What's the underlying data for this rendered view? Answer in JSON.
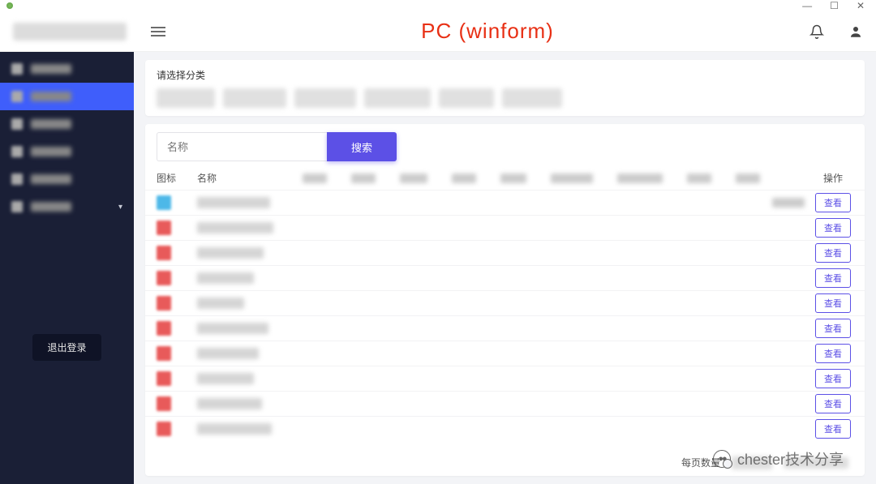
{
  "window": {
    "minimize": "—",
    "maximize": "☐",
    "close": "✕"
  },
  "header": {
    "title": "PC (winform)",
    "bell_icon": "bell-icon",
    "user_icon": "user-icon"
  },
  "sidebar": {
    "items": [
      {
        "label": "████",
        "active": false
      },
      {
        "label": "████",
        "active": true
      },
      {
        "label": "████站",
        "active": false
      },
      {
        "label": "███",
        "active": false
      },
      {
        "label": "█████站",
        "active": false
      },
      {
        "label": "███████",
        "active": false,
        "has_chevron": true
      }
    ],
    "logout": "退出登录"
  },
  "category": {
    "label": "请选择分类",
    "chips_widths": [
      72,
      78,
      76,
      82,
      68,
      74
    ]
  },
  "search": {
    "placeholder": "名称",
    "button": "搜索"
  },
  "table": {
    "headers": {
      "icon": "图标",
      "name": "名称",
      "op": "操作"
    },
    "mid_widths": [
      30,
      30,
      34,
      30,
      32,
      52,
      56,
      30,
      30
    ],
    "rows": [
      {
        "color": "blue",
        "name_w": 90,
        "extra": "████"
      },
      {
        "color": "red",
        "name_w": 94
      },
      {
        "color": "red",
        "name_w": 82
      },
      {
        "color": "red",
        "name_w": 70
      },
      {
        "color": "red",
        "name_w": 58
      },
      {
        "color": "red",
        "name_w": 88
      },
      {
        "color": "red",
        "name_w": 76
      },
      {
        "color": "red",
        "name_w": 70
      },
      {
        "color": "red",
        "name_w": 80
      },
      {
        "color": "red",
        "name_w": 92
      }
    ],
    "view_btn": "查看"
  },
  "pager": {
    "label": "每页数量"
  },
  "watermark": "chester技术分享"
}
